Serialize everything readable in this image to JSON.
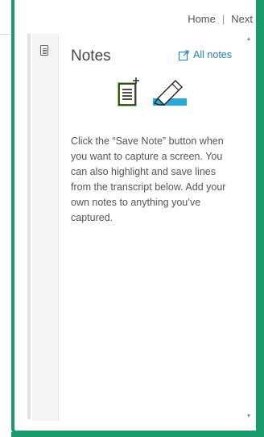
{
  "nav": {
    "home_label": "Home",
    "separator": "|",
    "next_label": "Next"
  },
  "sidebar": {
    "notes_tab_icon": "document-icon"
  },
  "notes_panel": {
    "title": "Notes",
    "all_notes_label": "All notes",
    "all_notes_icon": "external-link-icon",
    "illustration_icons": [
      "note-add-icon",
      "highlighter-icon"
    ],
    "description": "Click the “Save Note” button when you want to capture a screen. You can also highlight and save lines from the transcript below. Add your own notes to anything you’ve captured."
  },
  "colors": {
    "frame": "#1a9a6a",
    "link": "#2a7ab8",
    "note_icon_green": "#8ccf4d",
    "highlighter_blue": "#2aa8d8"
  }
}
